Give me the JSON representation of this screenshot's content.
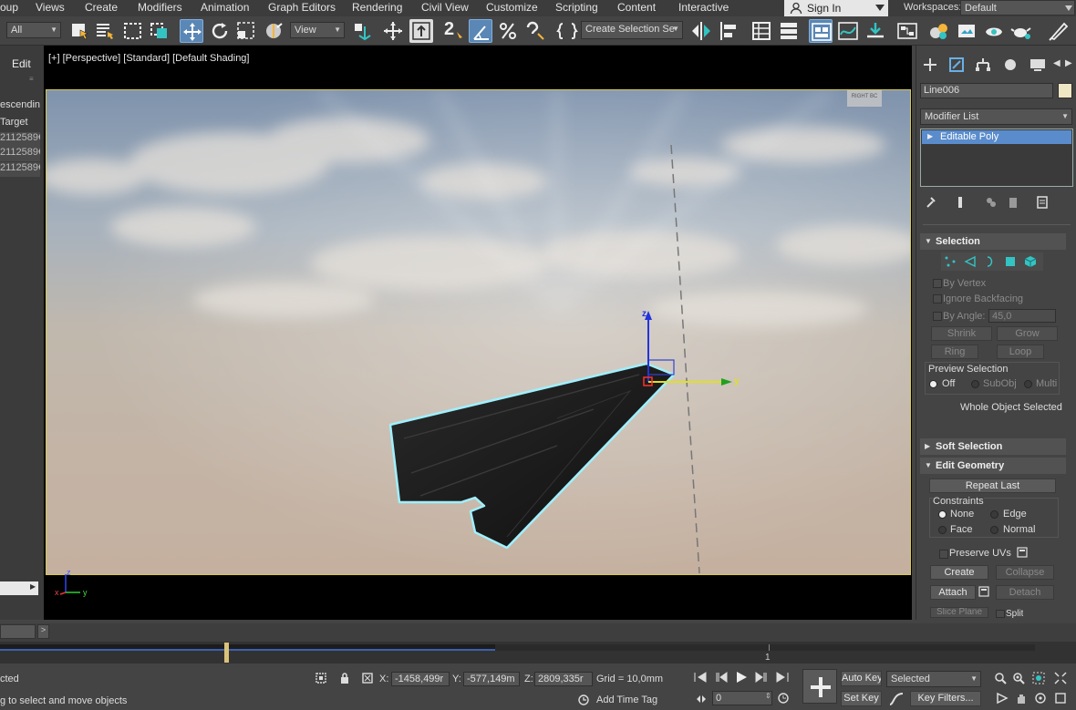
{
  "menu": {
    "items": [
      "oup",
      "Views",
      "Create",
      "Modifiers",
      "Animation",
      "Graph Editors",
      "Rendering",
      "Civil View",
      "Customize",
      "Scripting",
      "Content",
      "Interactive"
    ],
    "sign_in": "Sign In",
    "workspaces_label": "Workspaces:",
    "workspaces_value": "Default"
  },
  "toolbar": {
    "filter_value": "All",
    "ref_coord_value": "View",
    "snap_label": "2",
    "named_selection_placeholder": "Create Selection Se"
  },
  "left_panel": {
    "tab": "Edit",
    "rows": [
      "escending",
      "Target",
      "2112589€",
      "2112589€",
      "2112589€"
    ]
  },
  "viewport": {
    "label_plus": "[+]",
    "label_view": "[Perspective]",
    "label_mode": "[Standard]",
    "label_shading": "[Default Shading]",
    "gizmo_z": "z",
    "gizmo_y": "y",
    "axis_x": "x",
    "axis_y": "y",
    "axis_z": "z",
    "viewcube_text": "RIGHT  BC"
  },
  "command_panel": {
    "object_name": "Line006",
    "object_color": "#efe6c3",
    "modifier_list_label": "Modifier List",
    "stack_item": "Editable Poly",
    "selection": {
      "title": "Selection",
      "by_vertex": "By Vertex",
      "ignore_backfacing": "Ignore Backfacing",
      "by_angle_label": "By Angle:",
      "by_angle_value": "45,0",
      "shrink": "Shrink",
      "grow": "Grow",
      "ring": "Ring",
      "loop": "Loop",
      "preview_label": "Preview Selection",
      "preview_off": "Off",
      "preview_subobj": "SubObj",
      "preview_multi": "Multi",
      "status": "Whole Object Selected"
    },
    "soft_selection_title": "Soft Selection",
    "edit_geometry": {
      "title": "Edit Geometry",
      "repeat_last": "Repeat Last",
      "constraints_label": "Constraints",
      "none": "None",
      "edge": "Edge",
      "face": "Face",
      "normal": "Normal",
      "preserve_uvs": "Preserve UVs",
      "create": "Create",
      "collapse": "Collapse",
      "attach": "Attach",
      "detach": "Detach",
      "slice_plane": "Slice Plane",
      "split": "Split"
    }
  },
  "timeline": {
    "frame_marker": "1",
    "slider_fraction": 0.46
  },
  "status": {
    "selected_text": "cted",
    "prompt": "g to select and move objects",
    "x_label": "X:",
    "x_value": "-1458,499r",
    "y_label": "Y:",
    "y_value": "-577,149m",
    "z_label": "Z:",
    "z_value": "2809,335r",
    "grid": "Grid = 10,0mm",
    "add_time_tag": "Add Time Tag",
    "frame_value": "0",
    "auto_key": "Auto Key",
    "set_key": "Set Key",
    "key_mode_value": "Selected",
    "key_filters": "Key Filters..."
  }
}
